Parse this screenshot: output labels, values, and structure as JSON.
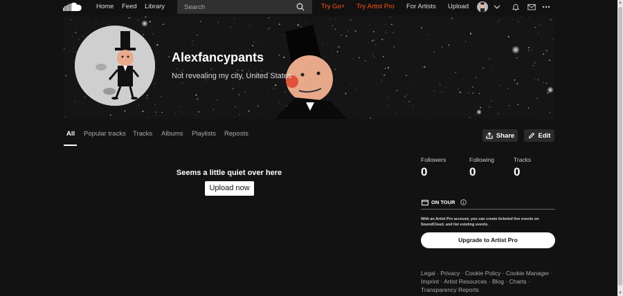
{
  "nav": {
    "home": "Home",
    "feed": "Feed",
    "library": "Library",
    "search_placeholder": "Search",
    "try_go": "Try Go+",
    "try_artist_pro": "Try Artist Pro",
    "for_artists": "For Artists",
    "upload": "Upload"
  },
  "profile": {
    "username": "Alexfancypants",
    "location": "Not revealing my city, United States"
  },
  "tabs": [
    "All",
    "Popular tracks",
    "Tracks",
    "Albums",
    "Playlists",
    "Reposts"
  ],
  "actions": {
    "share": "Share",
    "edit": "Edit"
  },
  "empty": {
    "title": "Seems a little quiet over here",
    "button": "Upload now"
  },
  "stats": [
    {
      "label": "Followers",
      "value": "0"
    },
    {
      "label": "Following",
      "value": "0"
    },
    {
      "label": "Tracks",
      "value": "0"
    }
  ],
  "tour": {
    "heading": "ON TOUR",
    "text": "With an Artist Pro account, you can create ticketed live events on SoundCloud, and list existing events.",
    "button": "Upgrade to Artist Pro"
  },
  "footer": {
    "links": [
      "Legal",
      "Privacy",
      "Cookie Policy",
      "Cookie Manager",
      "Imprint",
      "Artist Resources",
      "Blog",
      "Charts",
      "Transparency Reports"
    ]
  },
  "colors": {
    "accent": "#ff5500",
    "background": "#121212"
  }
}
